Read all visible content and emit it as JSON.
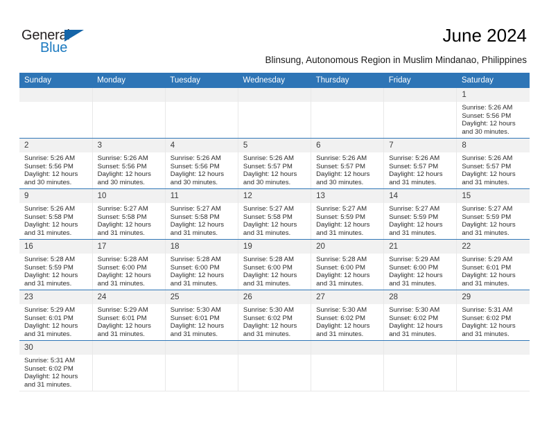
{
  "logo": {
    "word_one": "General",
    "word_two": "Blue",
    "flag_icon": "triangle-flag-icon"
  },
  "header": {
    "title": "June 2024",
    "subtitle": "Blinsung, Autonomous Region in Muslim Mindanao, Philippines"
  },
  "colors": {
    "header_bar": "#2e75b6",
    "row_divider": "#2e75b6",
    "day_band": "#f1f1f1",
    "logo_blue": "#1c7ac0",
    "flag_blue": "#1565a8",
    "cell_border": "#e8e8e8"
  },
  "calendar": {
    "weekday_headers": [
      "Sunday",
      "Monday",
      "Tuesday",
      "Wednesday",
      "Thursday",
      "Friday",
      "Saturday"
    ],
    "weeks": [
      [
        {
          "day": "",
          "lines": []
        },
        {
          "day": "",
          "lines": []
        },
        {
          "day": "",
          "lines": []
        },
        {
          "day": "",
          "lines": []
        },
        {
          "day": "",
          "lines": []
        },
        {
          "day": "",
          "lines": []
        },
        {
          "day": "1",
          "lines": [
            "Sunrise: 5:26 AM",
            "Sunset: 5:56 PM",
            "Daylight: 12 hours",
            "and 30 minutes."
          ]
        }
      ],
      [
        {
          "day": "2",
          "lines": [
            "Sunrise: 5:26 AM",
            "Sunset: 5:56 PM",
            "Daylight: 12 hours",
            "and 30 minutes."
          ]
        },
        {
          "day": "3",
          "lines": [
            "Sunrise: 5:26 AM",
            "Sunset: 5:56 PM",
            "Daylight: 12 hours",
            "and 30 minutes."
          ]
        },
        {
          "day": "4",
          "lines": [
            "Sunrise: 5:26 AM",
            "Sunset: 5:56 PM",
            "Daylight: 12 hours",
            "and 30 minutes."
          ]
        },
        {
          "day": "5",
          "lines": [
            "Sunrise: 5:26 AM",
            "Sunset: 5:57 PM",
            "Daylight: 12 hours",
            "and 30 minutes."
          ]
        },
        {
          "day": "6",
          "lines": [
            "Sunrise: 5:26 AM",
            "Sunset: 5:57 PM",
            "Daylight: 12 hours",
            "and 30 minutes."
          ]
        },
        {
          "day": "7",
          "lines": [
            "Sunrise: 5:26 AM",
            "Sunset: 5:57 PM",
            "Daylight: 12 hours",
            "and 31 minutes."
          ]
        },
        {
          "day": "8",
          "lines": [
            "Sunrise: 5:26 AM",
            "Sunset: 5:57 PM",
            "Daylight: 12 hours",
            "and 31 minutes."
          ]
        }
      ],
      [
        {
          "day": "9",
          "lines": [
            "Sunrise: 5:26 AM",
            "Sunset: 5:58 PM",
            "Daylight: 12 hours",
            "and 31 minutes."
          ]
        },
        {
          "day": "10",
          "lines": [
            "Sunrise: 5:27 AM",
            "Sunset: 5:58 PM",
            "Daylight: 12 hours",
            "and 31 minutes."
          ]
        },
        {
          "day": "11",
          "lines": [
            "Sunrise: 5:27 AM",
            "Sunset: 5:58 PM",
            "Daylight: 12 hours",
            "and 31 minutes."
          ]
        },
        {
          "day": "12",
          "lines": [
            "Sunrise: 5:27 AM",
            "Sunset: 5:58 PM",
            "Daylight: 12 hours",
            "and 31 minutes."
          ]
        },
        {
          "day": "13",
          "lines": [
            "Sunrise: 5:27 AM",
            "Sunset: 5:59 PM",
            "Daylight: 12 hours",
            "and 31 minutes."
          ]
        },
        {
          "day": "14",
          "lines": [
            "Sunrise: 5:27 AM",
            "Sunset: 5:59 PM",
            "Daylight: 12 hours",
            "and 31 minutes."
          ]
        },
        {
          "day": "15",
          "lines": [
            "Sunrise: 5:27 AM",
            "Sunset: 5:59 PM",
            "Daylight: 12 hours",
            "and 31 minutes."
          ]
        }
      ],
      [
        {
          "day": "16",
          "lines": [
            "Sunrise: 5:28 AM",
            "Sunset: 5:59 PM",
            "Daylight: 12 hours",
            "and 31 minutes."
          ]
        },
        {
          "day": "17",
          "lines": [
            "Sunrise: 5:28 AM",
            "Sunset: 6:00 PM",
            "Daylight: 12 hours",
            "and 31 minutes."
          ]
        },
        {
          "day": "18",
          "lines": [
            "Sunrise: 5:28 AM",
            "Sunset: 6:00 PM",
            "Daylight: 12 hours",
            "and 31 minutes."
          ]
        },
        {
          "day": "19",
          "lines": [
            "Sunrise: 5:28 AM",
            "Sunset: 6:00 PM",
            "Daylight: 12 hours",
            "and 31 minutes."
          ]
        },
        {
          "day": "20",
          "lines": [
            "Sunrise: 5:28 AM",
            "Sunset: 6:00 PM",
            "Daylight: 12 hours",
            "and 31 minutes."
          ]
        },
        {
          "day": "21",
          "lines": [
            "Sunrise: 5:29 AM",
            "Sunset: 6:00 PM",
            "Daylight: 12 hours",
            "and 31 minutes."
          ]
        },
        {
          "day": "22",
          "lines": [
            "Sunrise: 5:29 AM",
            "Sunset: 6:01 PM",
            "Daylight: 12 hours",
            "and 31 minutes."
          ]
        }
      ],
      [
        {
          "day": "23",
          "lines": [
            "Sunrise: 5:29 AM",
            "Sunset: 6:01 PM",
            "Daylight: 12 hours",
            "and 31 minutes."
          ]
        },
        {
          "day": "24",
          "lines": [
            "Sunrise: 5:29 AM",
            "Sunset: 6:01 PM",
            "Daylight: 12 hours",
            "and 31 minutes."
          ]
        },
        {
          "day": "25",
          "lines": [
            "Sunrise: 5:30 AM",
            "Sunset: 6:01 PM",
            "Daylight: 12 hours",
            "and 31 minutes."
          ]
        },
        {
          "day": "26",
          "lines": [
            "Sunrise: 5:30 AM",
            "Sunset: 6:02 PM",
            "Daylight: 12 hours",
            "and 31 minutes."
          ]
        },
        {
          "day": "27",
          "lines": [
            "Sunrise: 5:30 AM",
            "Sunset: 6:02 PM",
            "Daylight: 12 hours",
            "and 31 minutes."
          ]
        },
        {
          "day": "28",
          "lines": [
            "Sunrise: 5:30 AM",
            "Sunset: 6:02 PM",
            "Daylight: 12 hours",
            "and 31 minutes."
          ]
        },
        {
          "day": "29",
          "lines": [
            "Sunrise: 5:31 AM",
            "Sunset: 6:02 PM",
            "Daylight: 12 hours",
            "and 31 minutes."
          ]
        }
      ],
      [
        {
          "day": "30",
          "lines": [
            "Sunrise: 5:31 AM",
            "Sunset: 6:02 PM",
            "Daylight: 12 hours",
            "and 31 minutes."
          ]
        },
        {
          "day": "",
          "lines": []
        },
        {
          "day": "",
          "lines": []
        },
        {
          "day": "",
          "lines": []
        },
        {
          "day": "",
          "lines": []
        },
        {
          "day": "",
          "lines": []
        },
        {
          "day": "",
          "lines": []
        }
      ]
    ]
  }
}
